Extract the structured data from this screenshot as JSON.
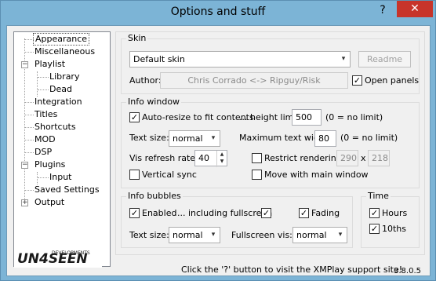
{
  "window": {
    "title": "Options and stuff",
    "help": "?",
    "close": "✕"
  },
  "tree": {
    "items": [
      {
        "label": "Appearance"
      },
      {
        "label": "Miscellaneous"
      },
      {
        "label": "Playlist"
      },
      {
        "label": "Library"
      },
      {
        "label": "Dead"
      },
      {
        "label": "Integration"
      },
      {
        "label": "Titles"
      },
      {
        "label": "Shortcuts"
      },
      {
        "label": "MOD"
      },
      {
        "label": "DSP"
      },
      {
        "label": "Plugins"
      },
      {
        "label": "Input"
      },
      {
        "label": "Saved Settings"
      },
      {
        "label": "Output"
      }
    ],
    "expanders": {
      "playlist": "−",
      "plugins": "−",
      "output": "+"
    }
  },
  "logo": {
    "text": "UN4SEEN",
    "sub": "DEVELOPMENTS"
  },
  "skin": {
    "group_label": "Skin",
    "selected": "Default skin",
    "readme_label": "Readme",
    "author_label": "Author:",
    "author_value": "Chris Corrado <-> Ripguy/Risk",
    "open_panels_label": "Open panels"
  },
  "info_window": {
    "group_label": "Info window",
    "autoresize_label": "Auto-resize to fit contents",
    "height_limit_label": "... height limit:",
    "height_limit_value": "500",
    "height_limit_note": "(0 = no limit)",
    "text_size_label": "Text size:",
    "text_size_value": "normal",
    "max_width_label": "Maximum text width:",
    "max_width_value": "80",
    "max_width_note": "(0 = no limit)",
    "refresh_label": "Vis refresh rate:",
    "refresh_value": "40",
    "restrict_label": "Restrict rendering:",
    "restrict_w": "290",
    "restrict_x": "x",
    "restrict_h": "218",
    "vsync_label": "Vertical sync",
    "move_label": "Move with main window"
  },
  "info_bubbles": {
    "group_label": "Info bubbles",
    "enabled_label": "Enabled",
    "fullscreen_label": "... including fullscreen",
    "fading_label": "Fading",
    "text_size_label": "Text size:",
    "text_size_value": "normal",
    "fullscreen_vis_label": "Fullscreen vis:",
    "fullscreen_vis_value": "normal"
  },
  "time": {
    "group_label": "Time",
    "hours_label": "Hours",
    "tenths_label": "10ths"
  },
  "footer": {
    "message": "Click the '?' button to visit the XMPlay support site!",
    "version": "3.8.0.5"
  },
  "check": "✓",
  "arrow": "▾",
  "spin_up": "▲",
  "spin_down": "▼"
}
